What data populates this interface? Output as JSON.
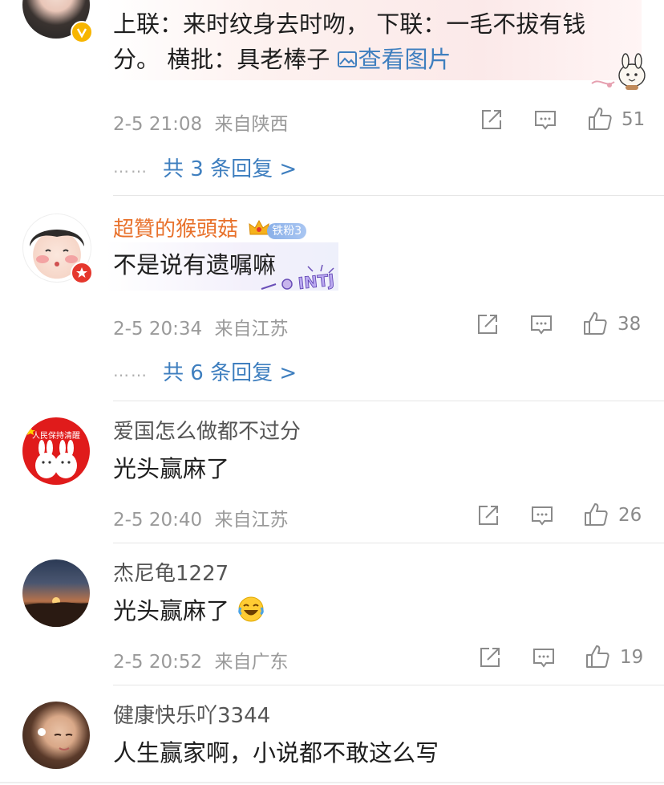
{
  "comments": [
    {
      "content_line1": "上联：来时纹身去时吻，  下联：一毛不拔有钱",
      "content_line2": "分。     横批：具老棒子",
      "view_image": "查看图片",
      "date": "2-5 21:08",
      "location": "来自陕西",
      "likes": "51",
      "replies": "共 3 条回复 >"
    },
    {
      "username": "超贊的猴頭菇",
      "fan_badge": "铁粉3",
      "content": "不是说有遗嘱嘛",
      "date": "2-5 20:34",
      "location": "来自江苏",
      "likes": "38",
      "replies": "共 6 条回复 >"
    },
    {
      "username": "爱国怎么做都不过分",
      "avatar_text": "人民保持清醒",
      "content": "光头赢麻了",
      "date": "2-5 20:40",
      "location": "来自江苏",
      "likes": "26"
    },
    {
      "username": "杰尼龟1227",
      "content": "光头赢麻了",
      "date": "2-5 20:52",
      "location": "来自广东",
      "likes": "19"
    },
    {
      "username": "健康快乐吖3344",
      "content": "人生赢家啊，小说都不敢这么写"
    }
  ],
  "replies_dots": "……",
  "colors": {
    "link": "#3f7fbf",
    "username_orange": "#e8712b",
    "meta": "#9a9a9a"
  }
}
